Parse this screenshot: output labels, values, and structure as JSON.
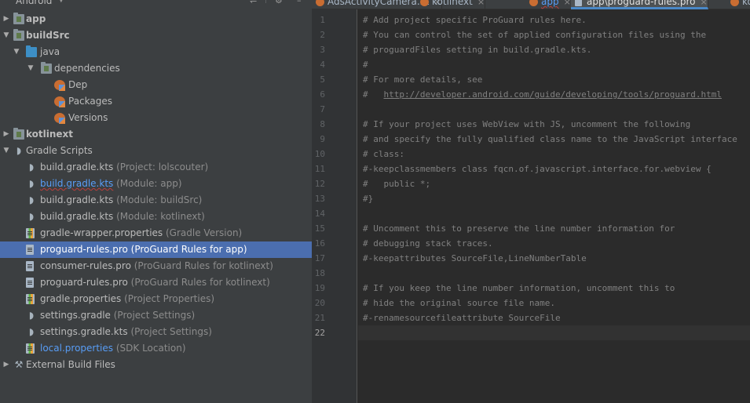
{
  "project_panel": {
    "view_mode": "Android",
    "items": [
      {
        "name": "app",
        "hint": "",
        "level": 0,
        "arrow": "collapsed",
        "icon": "module-folder-icon",
        "style": "bold"
      },
      {
        "name": "buildSrc",
        "hint": "",
        "level": 0,
        "arrow": "expanded",
        "icon": "module-folder-icon",
        "style": "bold"
      },
      {
        "name": "java",
        "hint": "",
        "level": 1,
        "arrow": "expanded",
        "icon": "source-folder-icon",
        "style": "normal"
      },
      {
        "name": "dependencies",
        "hint": "",
        "level": 2,
        "arrow": "expanded",
        "icon": "package-folder-icon",
        "style": "normal"
      },
      {
        "name": "Dep",
        "hint": "",
        "level": 3,
        "arrow": "",
        "icon": "kotlin-object-icon",
        "style": "normal"
      },
      {
        "name": "Packages",
        "hint": "",
        "level": 3,
        "arrow": "",
        "icon": "kotlin-object-icon",
        "style": "normal"
      },
      {
        "name": "Versions",
        "hint": "",
        "level": 3,
        "arrow": "",
        "icon": "kotlin-object-icon",
        "style": "normal"
      },
      {
        "name": "kotlinext",
        "hint": "",
        "level": 0,
        "arrow": "collapsed",
        "icon": "library-module-icon",
        "style": "bold"
      },
      {
        "name": "Gradle Scripts",
        "hint": "",
        "level": 0,
        "arrow": "expanded",
        "icon": "gradle-icon",
        "style": "normal"
      },
      {
        "name": "build.gradle.kts",
        "hint": "(Project: lolscouter)",
        "level": 1,
        "arrow": "",
        "icon": "gradle-kts-icon",
        "style": "normal"
      },
      {
        "name": "build.gradle.kts",
        "hint": "(Module: app)",
        "level": 1,
        "arrow": "",
        "icon": "gradle-kts-icon",
        "style": "error"
      },
      {
        "name": "build.gradle.kts",
        "hint": "(Module: buildSrc)",
        "level": 1,
        "arrow": "",
        "icon": "gradle-kts-icon",
        "style": "normal"
      },
      {
        "name": "build.gradle.kts",
        "hint": "(Module: kotlinext)",
        "level": 1,
        "arrow": "",
        "icon": "gradle-kts-icon",
        "style": "normal"
      },
      {
        "name": "gradle-wrapper.properties",
        "hint": "(Gradle Version)",
        "level": 1,
        "arrow": "",
        "icon": "properties-icon",
        "style": "normal"
      },
      {
        "name": "proguard-rules.pro",
        "hint": "(ProGuard Rules for app)",
        "level": 1,
        "arrow": "",
        "icon": "text-file-icon",
        "style": "selected"
      },
      {
        "name": "consumer-rules.pro",
        "hint": "(ProGuard Rules for kotlinext)",
        "level": 1,
        "arrow": "",
        "icon": "text-file-icon",
        "style": "normal"
      },
      {
        "name": "proguard-rules.pro",
        "hint": "(ProGuard Rules for kotlinext)",
        "level": 1,
        "arrow": "",
        "icon": "text-file-icon",
        "style": "normal"
      },
      {
        "name": "gradle.properties",
        "hint": "(Project Properties)",
        "level": 1,
        "arrow": "",
        "icon": "properties-icon",
        "style": "normal"
      },
      {
        "name": "settings.gradle",
        "hint": "(Project Settings)",
        "level": 1,
        "arrow": "",
        "icon": "gradle-icon",
        "style": "normal"
      },
      {
        "name": "settings.gradle.kts",
        "hint": "(Project Settings)",
        "level": 1,
        "arrow": "",
        "icon": "gradle-kts-icon",
        "style": "normal"
      },
      {
        "name": "local.properties",
        "hint": "(SDK Location)",
        "level": 1,
        "arrow": "",
        "icon": "properties-icon",
        "style": "blue"
      },
      {
        "name": "External Build Files",
        "hint": "",
        "level": 0,
        "arrow": "collapsed",
        "icon": "tools-icon",
        "style": "normal"
      }
    ]
  },
  "tabs": [
    {
      "label": "AdsActivityCamera.kt",
      "icon": "kotlin-file-icon",
      "active": false,
      "error": false
    },
    {
      "label": "kotlinext",
      "icon": "kotlin-file-icon",
      "active": false,
      "error": false
    },
    {
      "label": "app",
      "icon": "kotlin-file-icon",
      "active": false,
      "error": true
    },
    {
      "label": "app\\proguard-rules.pro",
      "icon": "text-file-icon",
      "active": true,
      "error": false
    },
    {
      "label": "kotl",
      "icon": "kotlin-file-icon",
      "active": false,
      "error": false
    }
  ],
  "editor": {
    "current_line": 22,
    "lines": [
      "# Add project specific ProGuard rules here.",
      "# You can control the set of applied configuration files using the",
      "# proguardFiles setting in build.gradle.kts.",
      "#",
      "# For more details, see",
      "#   http://developer.android.com/guide/developing/tools/proguard.html",
      "",
      "# If your project uses WebView with JS, uncomment the following",
      "# and specify the fully qualified class name to the JavaScript interface",
      "# class:",
      "#-keepclassmembers class fqcn.of.javascript.interface.for.webview {",
      "#   public *;",
      "#}",
      "",
      "# Uncomment this to preserve the line number information for",
      "# debugging stack traces.",
      "#-keepattributes SourceFile,LineNumberTable",
      "",
      "# If you keep the line number information, uncomment this to",
      "# hide the original source file name.",
      "#-renamesourcefileattribute SourceFile",
      ""
    ],
    "link_text": "http://developer.android.com/guide/developing/tools/proguard.html"
  },
  "colors": {
    "panel_bg": "#3c3f41",
    "editor_bg": "#2b2b2b",
    "selection": "#4b6eaf",
    "comment": "#808080",
    "link": "#589df6"
  }
}
